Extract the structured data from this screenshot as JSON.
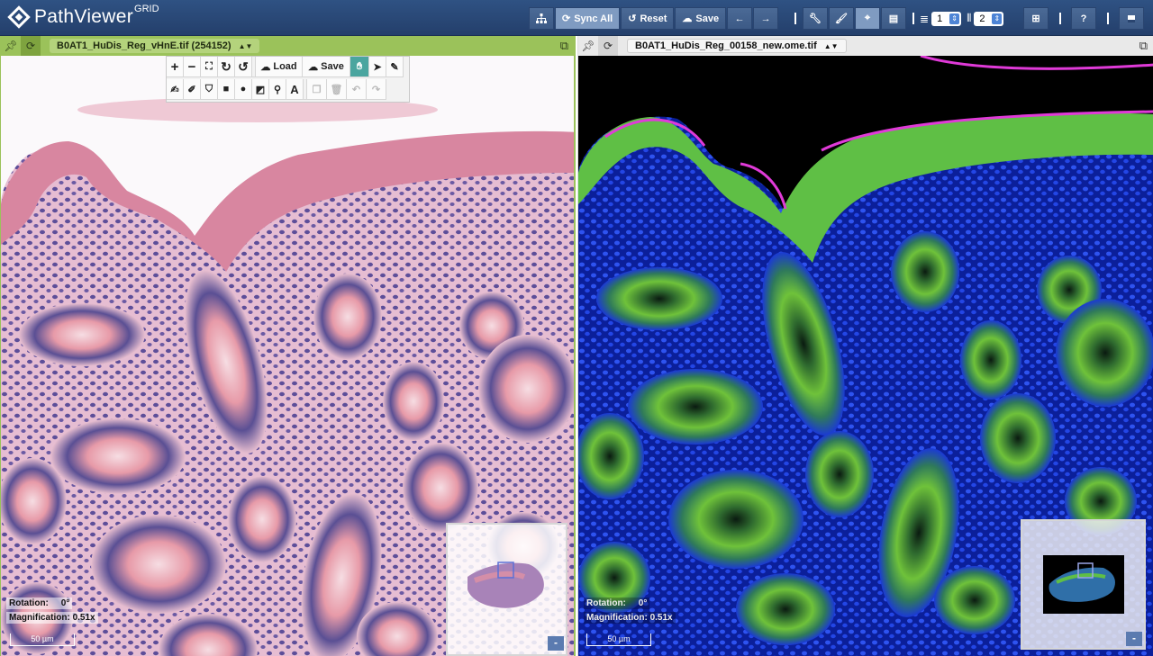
{
  "app": {
    "name": "PathViewer",
    "superscript": "GRID"
  },
  "toolbar": {
    "sync_all": "Sync All",
    "reset": "Reset",
    "save": "Save",
    "rows_value": "1",
    "cols_value": "2",
    "help": "?"
  },
  "panels": [
    {
      "filename": "B0AT1_HuDis_Reg_vHnE.tif (254152)",
      "rotation_label": "Rotation:",
      "rotation_value": "0°",
      "magnification_label": "Magnification:",
      "magnification_value": "0.51x",
      "scale": "50 µm",
      "navigator_minimize": "-",
      "accent": "#9bc25a"
    },
    {
      "filename": "B0AT1_HuDis_Reg_00158_new.ome.tif",
      "rotation_label": "Rotation:",
      "rotation_value": "0°",
      "magnification_label": "Magnification:",
      "magnification_value": "0.51x",
      "scale": "50 µm",
      "navigator_minimize": "-",
      "accent": "#e9e9e9"
    }
  ],
  "viewer_tools": {
    "load": "Load",
    "save": "Save"
  }
}
